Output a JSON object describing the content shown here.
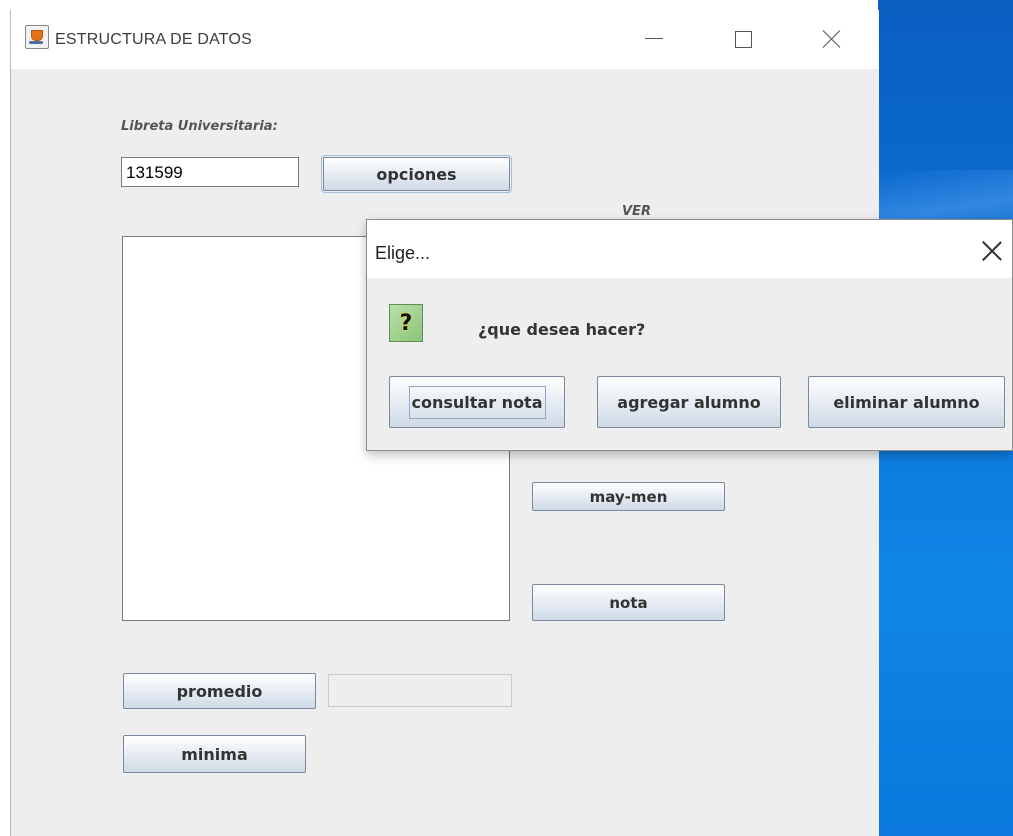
{
  "window": {
    "title": "ESTRUCTURA DE DATOS"
  },
  "form": {
    "libreta_label": "Libreta Universitaria:",
    "libreta_value": "131599",
    "opciones_label": "opciones",
    "ver_label": "VER",
    "maymen_label": "may-men",
    "nota_label": "nota",
    "promedio_label": "promedio",
    "promedio_value": "",
    "minima_label": "minima"
  },
  "dialog": {
    "title": "Elige...",
    "icon": "question-icon",
    "icon_glyph": "?",
    "message": "¿que desea hacer?",
    "buttons": [
      "consultar nota",
      "agregar alumno",
      "eliminar alumno"
    ]
  },
  "colors": {
    "window_bg": "#eeeeee",
    "desktop": "#0b6fd6",
    "icon_green": "#8cc57a"
  }
}
